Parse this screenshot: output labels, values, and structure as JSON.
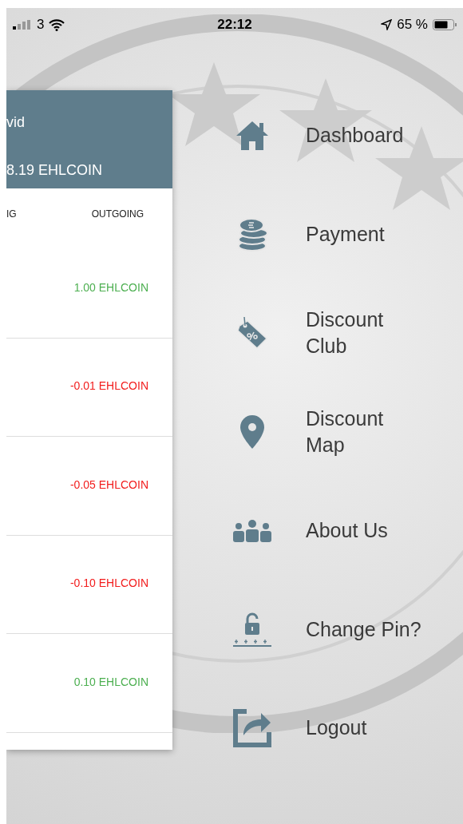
{
  "status_bar": {
    "carrier": "3",
    "time": "22:12",
    "battery": "65 %"
  },
  "wallet": {
    "name": "vid",
    "balance": "8.19 EHLCOIN",
    "columns": [
      "IG",
      "OUTGOING"
    ],
    "transactions": [
      {
        "amount": "1.00 EHLCOIN",
        "kind": "credit"
      },
      {
        "amount": "-0.01 EHLCOIN",
        "kind": "debit"
      },
      {
        "amount": "-0.05 EHLCOIN",
        "kind": "debit"
      },
      {
        "amount": "-0.10 EHLCOIN",
        "kind": "debit"
      },
      {
        "amount": "0.10 EHLCOIN",
        "kind": "credit"
      }
    ]
  },
  "menu": {
    "items": [
      {
        "label": "Dashboard",
        "kind": "home"
      },
      {
        "label": "Payment",
        "kind": "coins"
      },
      {
        "label": "Discount Club",
        "kind": "tag"
      },
      {
        "label": "Discount Map",
        "kind": "pin"
      },
      {
        "label": "About Us",
        "kind": "people"
      },
      {
        "label": "Change Pin?",
        "kind": "lock"
      },
      {
        "label": "Logout",
        "kind": "share"
      }
    ]
  }
}
